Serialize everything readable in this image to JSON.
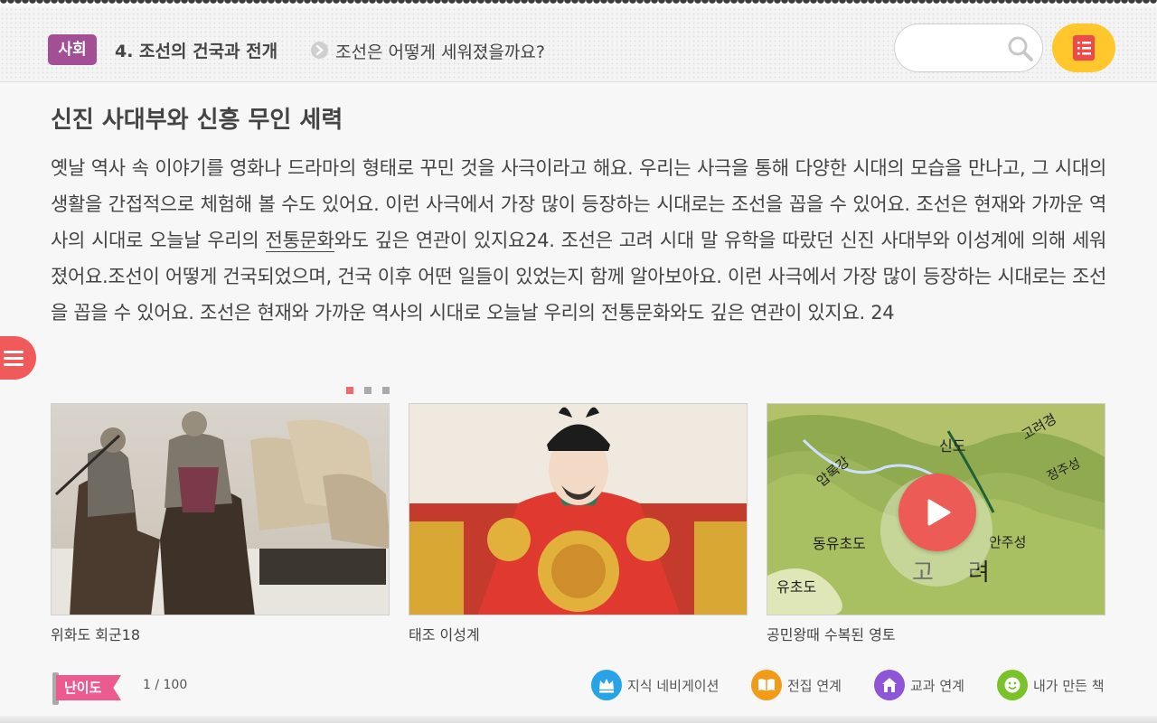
{
  "header": {
    "subject": "사회",
    "chapter": "4. 조선의 건국과 전개",
    "lesson": "조선은 어떻게 세워졌을까요?",
    "search_placeholder": ""
  },
  "content": {
    "title": "신진 사대부와 신흥 무인 세력",
    "paragraph_before": "옛날 역사 속 이야기를 영화나 드라마의 형태로 꾸민 것을 사극이라고 해요. 우리는 사극을 통해 다양한 시대의 모습을 만나고, 그 시대의 생활을 간접적으로 체험해 볼 수도 있어요. 이런 사극에서 가장 많이 등장하는 시대로는 조선을 꼽을 수 있어요. 조선은 현재와 가까운 역사의 시대로 오늘날 우리의 ",
    "term": "전통문화",
    "paragraph_after": "와도 깊은 연관이 있지요24. 조선은 고려 시대 말 유학을 따랐던 신진 사대부와 이성계에 의해 세워졌어요.조선이 어떻게 건국되었으며, 건국 이후 어떤 일들이 있었는지 함께 알아보아요. 이런 사극에서 가장 많이 등장하는 시대로는 조선을 꼽을 수 있어요. 조선은 현재와 가까운 역사의 시대로 오늘날 우리의 전통문화와도 깊은 연관이 있지요. 24"
  },
  "carousel": {
    "page_count": 3,
    "active_index": 0
  },
  "cards": [
    {
      "caption": "위화도 회군18"
    },
    {
      "caption": "태조 이성계"
    },
    {
      "caption": "공민왕때 수복된 영토"
    }
  ],
  "map_labels": {
    "l1": "신도",
    "l2": "압록강",
    "l3": "고려경",
    "l4": "정주성",
    "l5": "동유초도",
    "l6": "안주성",
    "l7": "유초도",
    "l8": "고",
    "l9": "려"
  },
  "footer": {
    "difficulty_label": "난이도",
    "page_indicator": "1 / 100",
    "links": [
      {
        "label": "지식 네비게이션",
        "icon": "crown-icon",
        "color": "#29a3e8"
      },
      {
        "label": "전집 연계",
        "icon": "open-book-icon",
        "color": "#f29b18"
      },
      {
        "label": "교과 연계",
        "icon": "school-icon",
        "color": "#8e55d8"
      },
      {
        "label": "내가 만든 책",
        "icon": "smile-icon",
        "color": "#7ac22a"
      }
    ]
  },
  "colors": {
    "subject_badge": "#a24f96",
    "book_button": "#ffc72c",
    "side_menu": "#f05a5a",
    "play_button": "#ec5b56",
    "difficulty_badge": "#ec5b8f"
  }
}
